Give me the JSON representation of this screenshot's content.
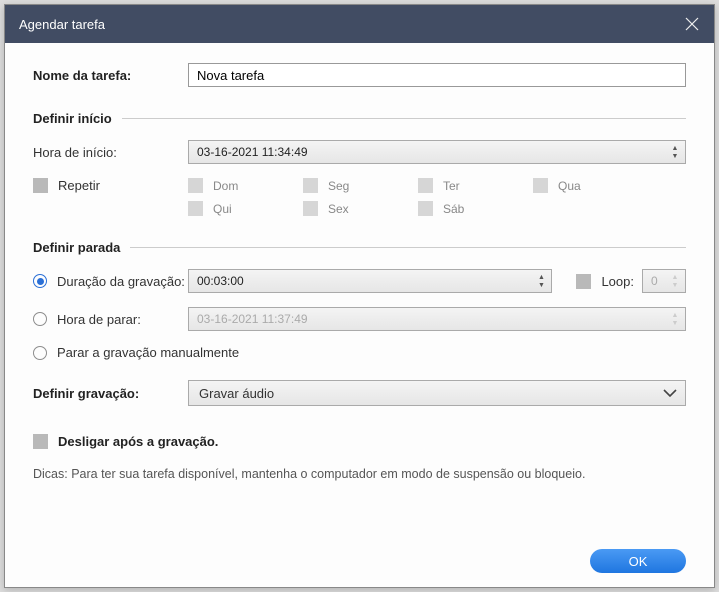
{
  "titlebar": {
    "title": "Agendar tarefa"
  },
  "taskname": {
    "label": "Nome da tarefa:",
    "value": "Nova tarefa"
  },
  "section_start": "Definir início",
  "start_time": {
    "label": "Hora de início:",
    "value": "03-16-2021 11:34:49"
  },
  "repeat": {
    "label": "Repetir",
    "days": {
      "sun": "Dom",
      "mon": "Seg",
      "tue": "Ter",
      "wed": "Qua",
      "thu": "Qui",
      "fri": "Sex",
      "sat": "Sáb"
    }
  },
  "section_stop": "Definir parada",
  "stop": {
    "duration_label": "Duração da gravação:",
    "duration_value": "00:03:00",
    "loop_label": "Loop:",
    "loop_value": "0",
    "stoptime_label": "Hora de parar:",
    "stoptime_value": "03-16-2021 11:37:49",
    "manual_label": "Parar a gravação manualmente"
  },
  "record_def": {
    "label": "Definir gravação:",
    "value": "Gravar áudio"
  },
  "shutdown_label": "Desligar após a gravação.",
  "tips": "Dicas: Para ter sua tarefa disponível, mantenha o computador em modo de suspensão ou bloqueio.",
  "ok": "OK"
}
